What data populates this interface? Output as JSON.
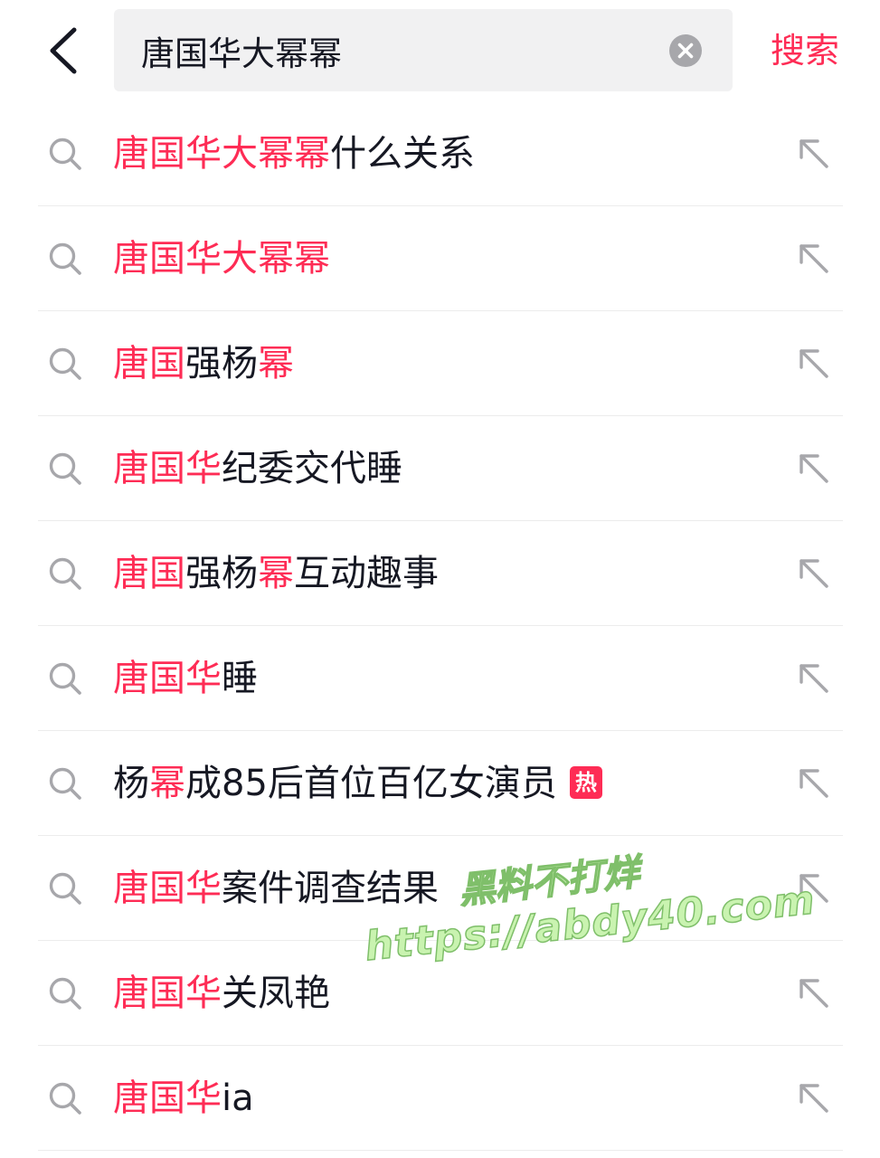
{
  "header": {
    "search_value": "唐国华大幂幂",
    "search_button_label": "搜索"
  },
  "suggestions": [
    {
      "segments": [
        {
          "text": "唐国华大幂幂",
          "hl": true
        },
        {
          "text": "什么关系",
          "hl": false
        }
      ]
    },
    {
      "segments": [
        {
          "text": "唐国华大幂幂",
          "hl": true
        }
      ]
    },
    {
      "segments": [
        {
          "text": "唐国",
          "hl": true
        },
        {
          "text": "强杨",
          "hl": false
        },
        {
          "text": "幂",
          "hl": true
        }
      ]
    },
    {
      "segments": [
        {
          "text": "唐国华",
          "hl": true
        },
        {
          "text": "纪委交代睡",
          "hl": false
        }
      ]
    },
    {
      "segments": [
        {
          "text": "唐国",
          "hl": true
        },
        {
          "text": "强杨",
          "hl": false
        },
        {
          "text": "幂",
          "hl": true
        },
        {
          "text": "互动趣事",
          "hl": false
        }
      ]
    },
    {
      "segments": [
        {
          "text": "唐国华",
          "hl": true
        },
        {
          "text": "睡",
          "hl": false
        }
      ]
    },
    {
      "segments": [
        {
          "text": "杨",
          "hl": false
        },
        {
          "text": "幂",
          "hl": true
        },
        {
          "text": "成85后首位百亿女演员",
          "hl": false
        }
      ],
      "badge": "热"
    },
    {
      "segments": [
        {
          "text": "唐国华",
          "hl": true
        },
        {
          "text": "案件调查结果",
          "hl": false
        }
      ]
    },
    {
      "segments": [
        {
          "text": "唐国华",
          "hl": true
        },
        {
          "text": "关凤艳",
          "hl": false
        }
      ]
    },
    {
      "segments": [
        {
          "text": "唐国华",
          "hl": true
        },
        {
          "text": "ia",
          "hl": false
        }
      ]
    }
  ],
  "watermark": {
    "line1": "黑料不打烊",
    "line2": "https://abdy40.com"
  },
  "icons": {
    "back": "chevron-left-icon",
    "clear": "clear-circle-icon",
    "row_leading": "search-icon",
    "row_trailing": "fill-query-arrow-icon"
  },
  "colors": {
    "accent": "#fe2c55",
    "text": "#161823",
    "icon": "#a7a7ab",
    "search_bg": "#f1f1f2"
  }
}
